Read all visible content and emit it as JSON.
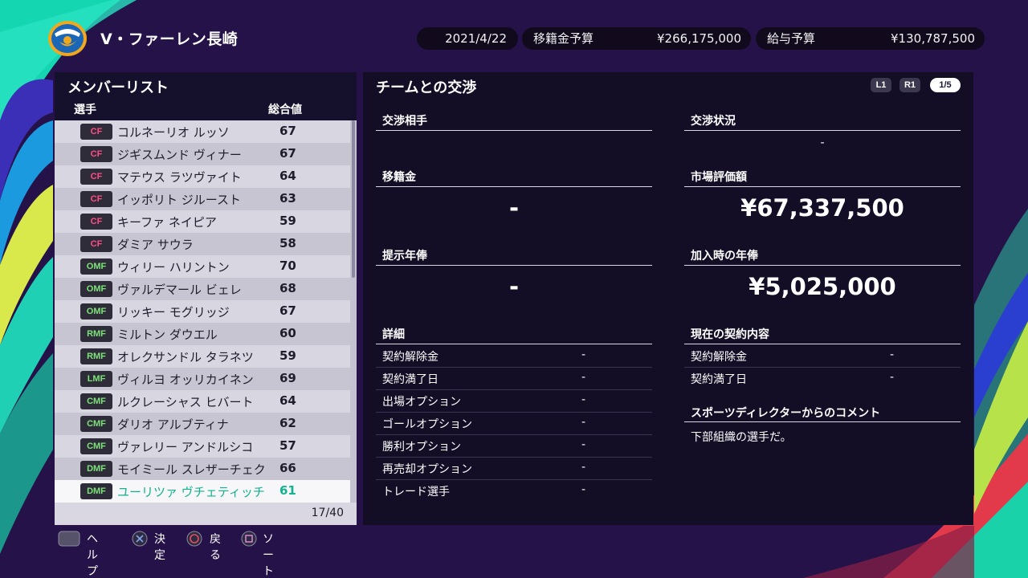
{
  "header": {
    "club_name": "V・ファーレン長崎",
    "date": "2021/4/22",
    "transfer_budget_label": "移籍金予算",
    "transfer_budget_value": "¥266,175,000",
    "salary_budget_label": "給与予算",
    "salary_budget_value": "¥130,787,500"
  },
  "member_list": {
    "title": "メンバーリスト",
    "col_player": "選手",
    "col_overall": "総合値",
    "count": "17/40",
    "players": [
      {
        "pos": "CF",
        "name": "コルネーリオ ルッソ",
        "ovr": "67"
      },
      {
        "pos": "CF",
        "name": "ジギスムンド ヴィナー",
        "ovr": "67"
      },
      {
        "pos": "CF",
        "name": "マテウス ラツヴァイト",
        "ovr": "64"
      },
      {
        "pos": "CF",
        "name": "イッポリト ジルースト",
        "ovr": "63"
      },
      {
        "pos": "CF",
        "name": "キーファ ネイピア",
        "ovr": "59"
      },
      {
        "pos": "CF",
        "name": "ダミア サウラ",
        "ovr": "58"
      },
      {
        "pos": "OMF",
        "name": "ウィリー ハリントン",
        "ovr": "70"
      },
      {
        "pos": "OMF",
        "name": "ヴァルデマール ビェレ",
        "ovr": "68"
      },
      {
        "pos": "OMF",
        "name": "リッキー モグリッジ",
        "ovr": "67"
      },
      {
        "pos": "RMF",
        "name": "ミルトン ダウエル",
        "ovr": "60"
      },
      {
        "pos": "RMF",
        "name": "オレクサンドル タラネツ",
        "ovr": "59"
      },
      {
        "pos": "LMF",
        "name": "ヴィルヨ オッリカイネン",
        "ovr": "69"
      },
      {
        "pos": "CMF",
        "name": "ルクレーシャス ヒバート",
        "ovr": "64"
      },
      {
        "pos": "CMF",
        "name": "ダリオ アルブティナ",
        "ovr": "62"
      },
      {
        "pos": "CMF",
        "name": "ヴァレリー アンドルシコ",
        "ovr": "57"
      },
      {
        "pos": "DMF",
        "name": "モイミール スレザーチェク",
        "ovr": "66"
      },
      {
        "pos": "DMF",
        "name": "ユーリツァ ヴチェティッチ",
        "ovr": "61"
      }
    ]
  },
  "negotiation": {
    "title": "チームとの交渉",
    "l1": "L1",
    "r1": "R1",
    "page": "1/5",
    "partner_label": "交渉相手",
    "status_label": "交渉状況",
    "status_value": "-",
    "transfer_fee_label": "移籍金",
    "transfer_fee_value": "-",
    "market_value_label": "市場評価額",
    "market_value": "¥67,337,500",
    "offer_salary_label": "提示年俸",
    "offer_salary_value": "-",
    "joining_salary_label": "加入時の年俸",
    "joining_salary_value": "¥5,025,000",
    "details_label": "詳細",
    "details": [
      {
        "label": "契約解除金",
        "value": "-"
      },
      {
        "label": "契約満了日",
        "value": "-"
      },
      {
        "label": "出場オプション",
        "value": "-"
      },
      {
        "label": "ゴールオプション",
        "value": "-"
      },
      {
        "label": "勝利オプション",
        "value": "-"
      },
      {
        "label": "再売却オプション",
        "value": "-"
      },
      {
        "label": "トレード選手",
        "value": "-"
      }
    ],
    "current_contract_label": "現在の契約内容",
    "current_contract": [
      {
        "label": "契約解除金",
        "value": "-"
      },
      {
        "label": "契約満了日",
        "value": "-"
      }
    ],
    "comment_label": "スポーツディレクターからのコメント",
    "comment_text": "下部組織の選手だ。"
  },
  "hints": {
    "help": "ヘルプ",
    "confirm": "決定",
    "back": "戻る",
    "sort": "ソート"
  },
  "colors": {
    "background": "#241248",
    "forward_badge": "#ff4d86",
    "midfield_badge": "#7de37a",
    "selected_text": "#12b28e"
  }
}
